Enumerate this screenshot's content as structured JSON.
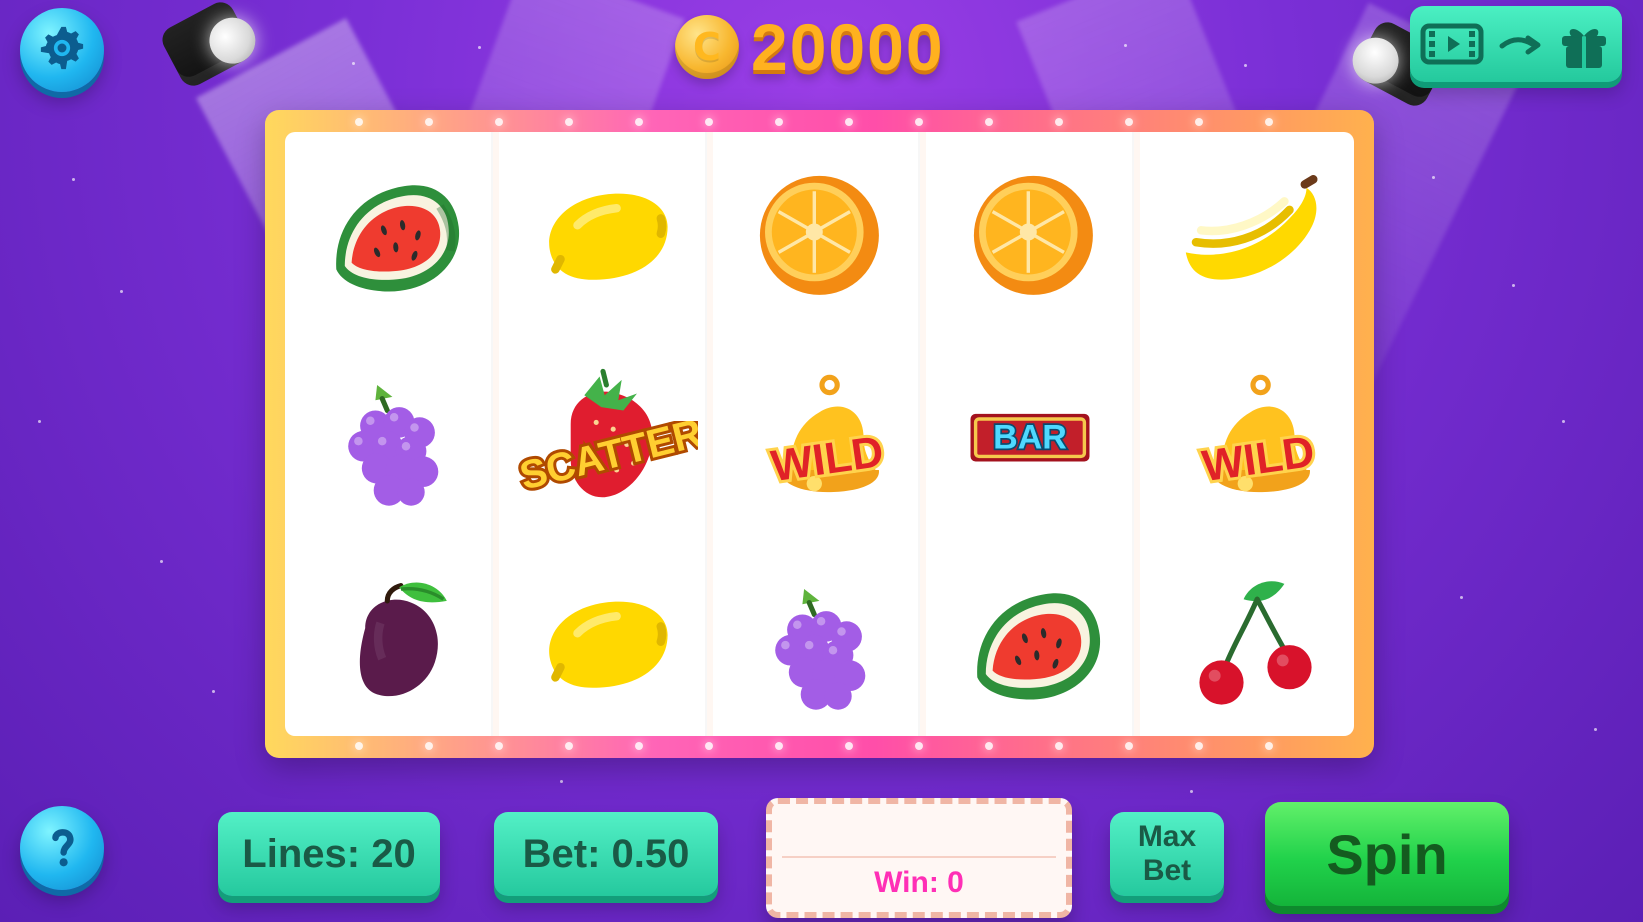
{
  "hud": {
    "coins": "20000",
    "controls": {
      "lines_label": "Lines: 20",
      "bet_label": "Bet: 0.50",
      "max_bet_line1": "Max",
      "max_bet_line2": "Bet",
      "spin_label": "Spin",
      "win_label": "Win: 0"
    }
  },
  "icons": {
    "settings": "gear-icon",
    "help": "help-question-icon",
    "reward": [
      "video-icon",
      "arrow-right-icon",
      "gift-icon"
    ]
  },
  "reels": [
    {
      "symbols": [
        "watermelon",
        "grapes",
        "plum"
      ]
    },
    {
      "symbols": [
        "lemon",
        "scatter",
        "lemon"
      ]
    },
    {
      "symbols": [
        "orange",
        "wild",
        "grapes"
      ]
    },
    {
      "symbols": [
        "orange",
        "bar",
        "watermelon"
      ]
    },
    {
      "symbols": [
        "banana",
        "wild",
        "cherries"
      ]
    }
  ],
  "symbol_text": {
    "scatter": "SCATTER",
    "wild": "WILD",
    "bar": "BAR"
  },
  "colors": {
    "bg_top": "#9a3ee6",
    "bg_bottom": "#5b1fb5",
    "accent_cyan": "#20b7f0",
    "accent_green": "#21d24b",
    "win_pink": "#ff2fb6",
    "coin_gold": "#ffb11f"
  }
}
